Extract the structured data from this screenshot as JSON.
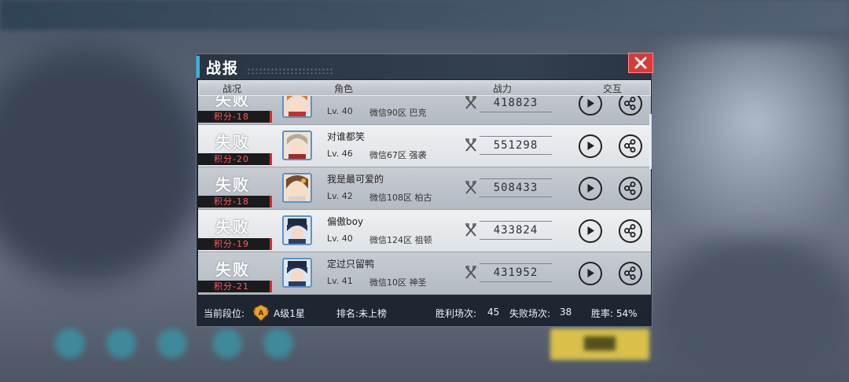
{
  "title": "战报",
  "columns": {
    "status": "战况",
    "character": "角色",
    "power": "战力",
    "interaction": "交互"
  },
  "rows": [
    {
      "result": "失败",
      "score": "积分-18",
      "name": "",
      "level": "Lv. 40",
      "server": "微信90区 巴克",
      "power": "418823"
    },
    {
      "result": "失败",
      "score": "积分-20",
      "name": "对谁都笑",
      "level": "Lv. 46",
      "server": "微信67区 强袭",
      "power": "551298"
    },
    {
      "result": "失败",
      "score": "积分-18",
      "name": "我是最可爱的",
      "level": "Lv. 42",
      "server": "微信108区 柏古",
      "power": "508433"
    },
    {
      "result": "失败",
      "score": "积分-19",
      "name": "偏傲boy",
      "level": "Lv. 40",
      "server": "微信124区 祖顿",
      "power": "433824"
    },
    {
      "result": "失败",
      "score": "积分-21",
      "name": "定过只留鸭",
      "level": "Lv. 41",
      "server": "微信10区 神圣",
      "power": "431952"
    }
  ],
  "footer": {
    "rank_label": "当前段位:",
    "rank_value": "A级1星",
    "ranking": "排名:未上榜",
    "wins_label": "胜利场次:",
    "wins": "45",
    "losses_label": "失败场次:",
    "losses": "38",
    "winrate": "胜率: 54%"
  },
  "colors": {
    "accent": "#2fb7e0",
    "close": "#d83a3a",
    "score_text": "#ff5a5a"
  },
  "icons": [
    "close-icon",
    "play-icon",
    "share-icon",
    "power-icon",
    "rank-badge-icon"
  ]
}
